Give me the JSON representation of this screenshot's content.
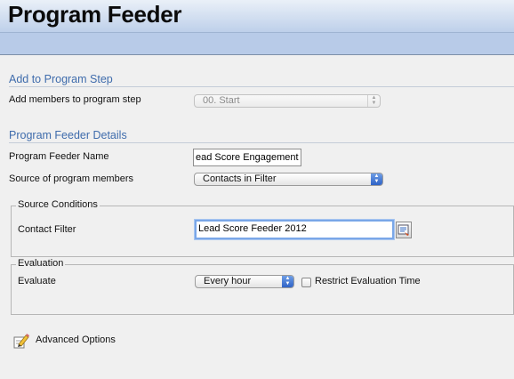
{
  "header": {
    "title": "Program Feeder"
  },
  "add_step": {
    "heading": "Add to Program Step",
    "members_label": "Add members to program step",
    "step_value": "00. Start"
  },
  "details": {
    "heading": "Program Feeder Details",
    "name_label": "Program Feeder Name",
    "name_value": "ead Score Engagement",
    "source_label": "Source of program members",
    "source_value": "Contacts in Filter"
  },
  "source_conditions": {
    "legend": "Source Conditions",
    "filter_label": "Contact Filter",
    "filter_value": "Lead Score Feeder 2012"
  },
  "evaluation": {
    "legend": "Evaluation",
    "evaluate_label": "Evaluate",
    "evaluate_value": "Every hour",
    "restrict_label": "Restrict Evaluation Time",
    "restrict_checked": false
  },
  "advanced": {
    "label": "Advanced Options"
  },
  "icons": {
    "select_arrows": "updown-arrows-icon",
    "filter_picker": "filter-picker-icon",
    "advanced": "pencil-edit-icon"
  }
}
